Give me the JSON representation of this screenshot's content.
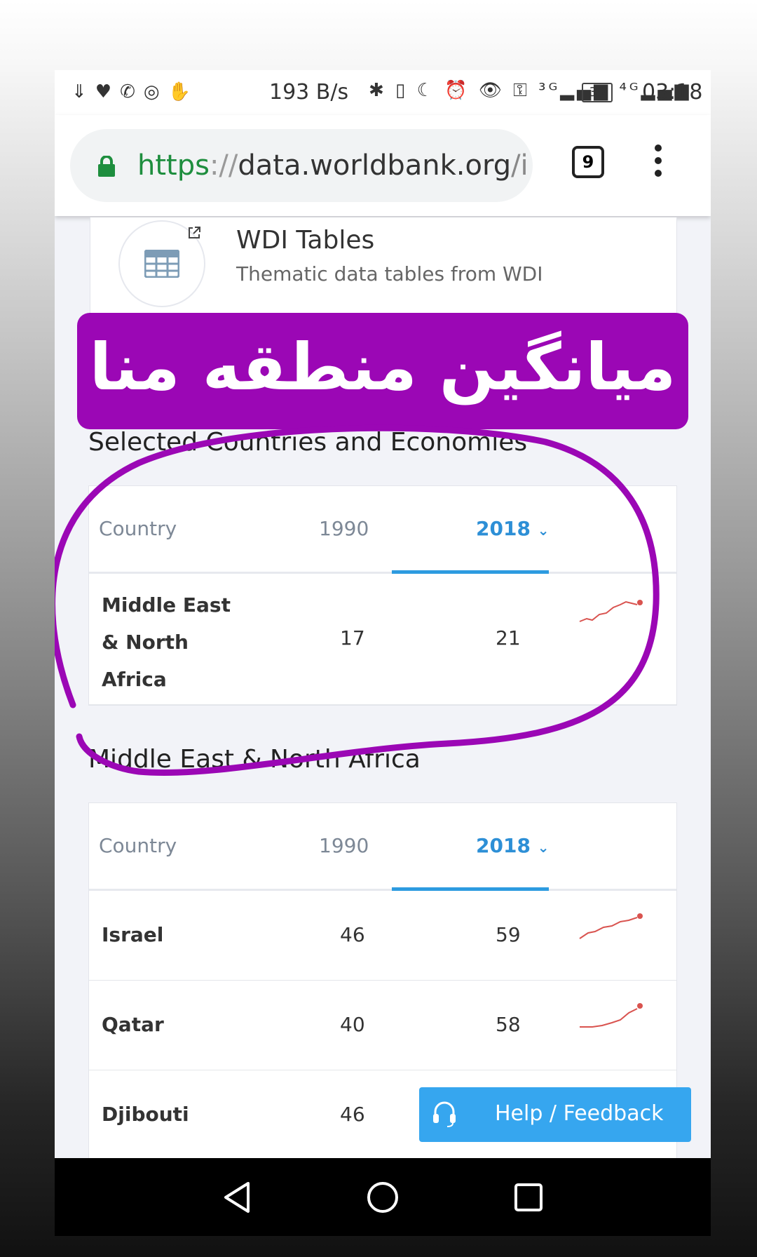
{
  "status_bar": {
    "speed": "193 B/s",
    "battery": "39",
    "time": "03:18",
    "left_icons": [
      "download-icon",
      "heart-icon",
      "whatsapp-icon",
      "instagram-icon",
      "hand-icon"
    ],
    "mid_icons": "✱ ▯ ☾ ⏰ 👁 ⚿ ³ᴳ▂▄▆ ⁴ᴳ▂▄▆"
  },
  "browser": {
    "url_scheme": "https",
    "url_sep": "://",
    "url_host": "data.worldbank.org",
    "url_path": "/in",
    "tab_count": "9"
  },
  "wdi_card": {
    "title": "WDI Tables",
    "subtitle": "Thematic data tables from WDI"
  },
  "banner": {
    "text": "میانگین منطقه منا"
  },
  "selected_section": {
    "title": "Selected Countries and Economies",
    "headers": {
      "country": "Country",
      "y1990": "1990",
      "y2018": "2018"
    },
    "rows": [
      {
        "name_lines": [
          "Middle East",
          "& North",
          "Africa"
        ],
        "v1990": "17",
        "v2018": "21"
      }
    ]
  },
  "mena_section": {
    "title": "Middle East & North Africa",
    "headers": {
      "country": "Country",
      "y1990": "1990",
      "y2018": "2018"
    },
    "rows": [
      {
        "name": "Israel",
        "v1990": "46",
        "v2018": "59"
      },
      {
        "name": "Qatar",
        "v1990": "40",
        "v2018": "58"
      },
      {
        "name": "Djibouti",
        "v1990": "46",
        "v2018": ""
      }
    ]
  },
  "help_button": {
    "label": "Help / Feedback"
  },
  "colors": {
    "accent": "#2d8fd6",
    "banner": "#9b07b5",
    "spark": "#d9534f",
    "help": "#36a6ef"
  }
}
